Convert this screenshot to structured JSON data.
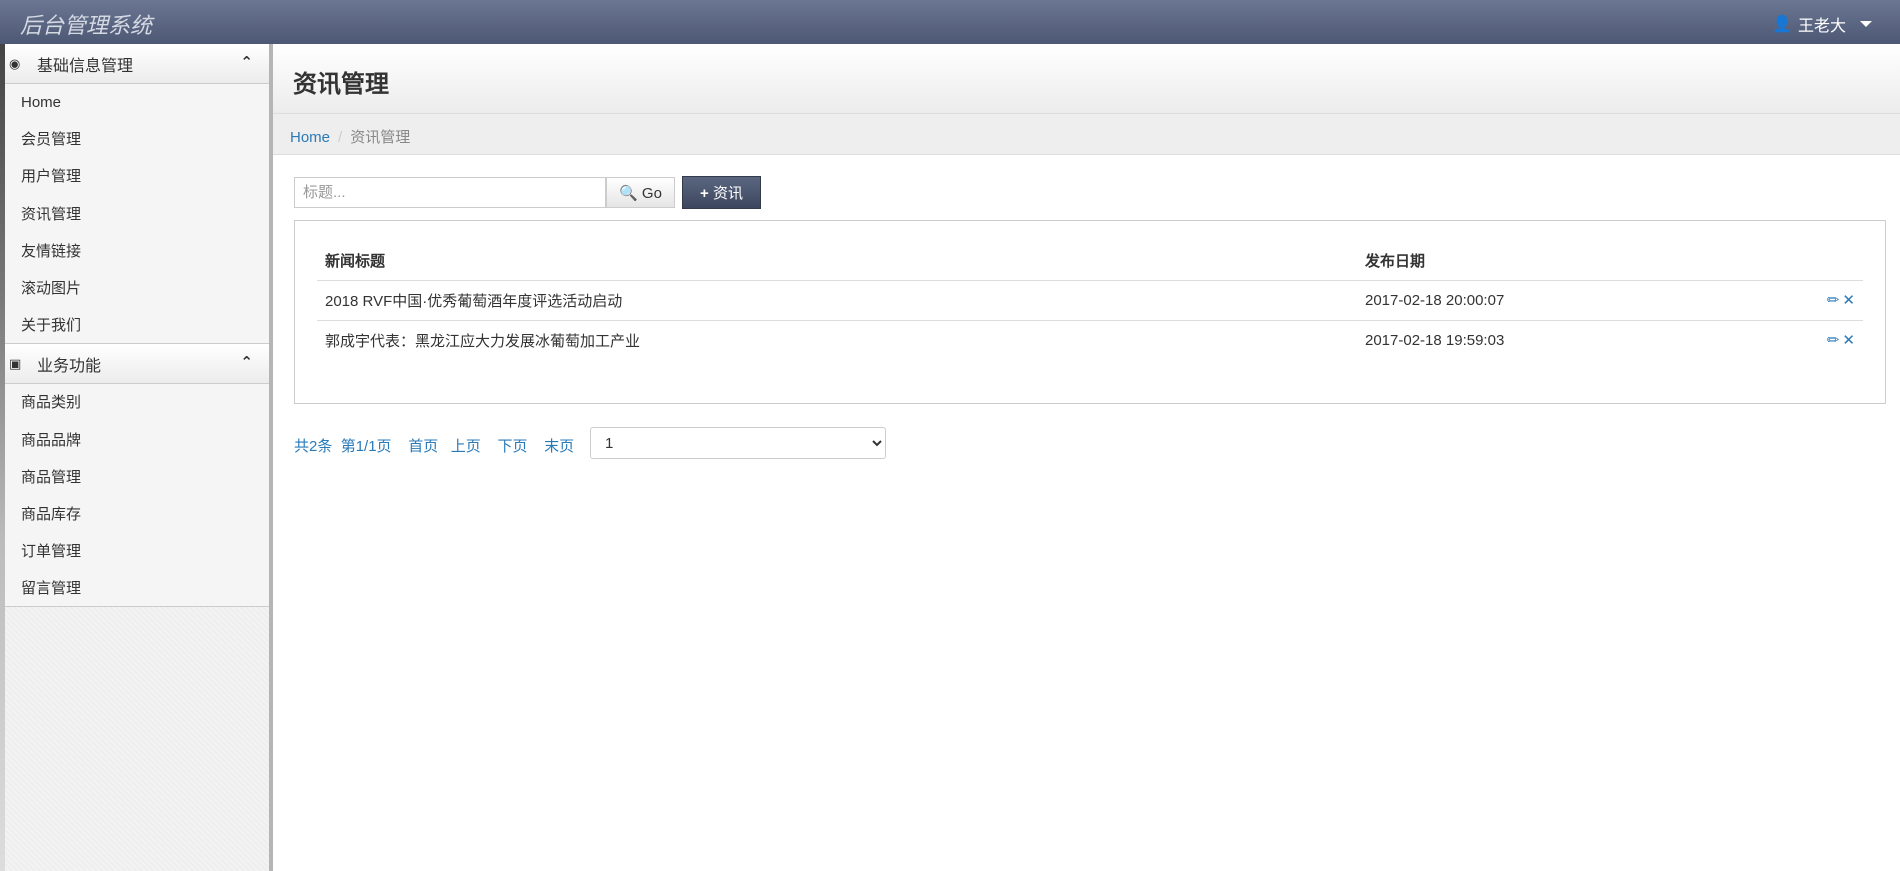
{
  "header": {
    "brand": "后台管理系统",
    "user": "王老大"
  },
  "sidebar": {
    "groups": [
      {
        "title": "基础信息管理",
        "items": [
          "Home",
          "会员管理",
          "用户管理",
          "资讯管理",
          "友情链接",
          "滚动图片",
          "关于我们"
        ]
      },
      {
        "title": "业务功能",
        "items": [
          "商品类别",
          "商品品牌",
          "商品管理",
          "商品库存",
          "订单管理",
          "留言管理"
        ]
      }
    ]
  },
  "page": {
    "title": "资讯管理",
    "breadcrumb": {
      "home": "Home",
      "current": "资讯管理"
    }
  },
  "toolbar": {
    "search_placeholder": "标题...",
    "go_label": "Go",
    "add_label": "资讯"
  },
  "table": {
    "headers": [
      "新闻标题",
      "发布日期"
    ],
    "rows": [
      {
        "title": "2018 RVF中国·优秀葡萄酒年度评选活动启动",
        "date": "2017-02-18 20:00:07"
      },
      {
        "title": "郭成宇代表：黑龙江应大力发展冰葡萄加工产业",
        "date": "2017-02-18 19:59:03"
      }
    ]
  },
  "pager": {
    "total": "共2条",
    "page": "第1/1页",
    "first": "首页",
    "prev": "上页",
    "next": "下页",
    "last": "末页",
    "selected": "1"
  }
}
